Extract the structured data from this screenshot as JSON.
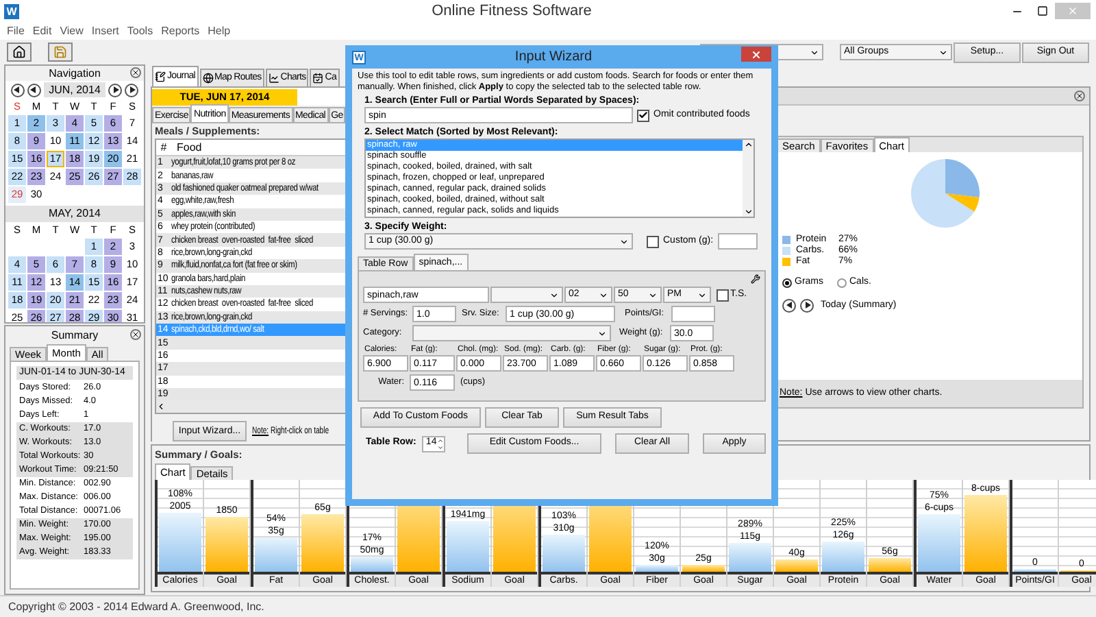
{
  "window": {
    "app_icon": "W",
    "title": "Online Fitness Software"
  },
  "menu": [
    "File",
    "Edit",
    "View",
    "Insert",
    "Tools",
    "Reports",
    "Help"
  ],
  "toolbar": {
    "group_filter": "All Groups",
    "buttons": [
      "Setup...",
      "Sign Out"
    ]
  },
  "navigation": {
    "title": "Navigation",
    "calendars": [
      {
        "month": "JUN, 2014",
        "weekdays": [
          {
            "label": "S",
            "marked": true
          },
          {
            "label": "M",
            "marked": false
          },
          {
            "label": "T",
            "marked": false
          },
          {
            "label": "W",
            "marked": false
          },
          {
            "label": "T",
            "marked": false
          },
          {
            "label": "F",
            "marked": false
          },
          {
            "label": "S",
            "marked": false
          }
        ],
        "weeks": [
          [
            {
              "day": "1",
              "color": "#c5e0f7",
              "selected": false,
              "marked": false
            },
            {
              "day": "2",
              "color": "#8ec0ea",
              "selected": false,
              "marked": false
            },
            {
              "day": "3",
              "color": "#c5e0f7",
              "selected": false,
              "marked": false
            },
            {
              "day": "4",
              "color": "#b4aee6",
              "selected": false,
              "marked": false
            },
            {
              "day": "5",
              "color": "#c5e0f7",
              "selected": false,
              "marked": false
            },
            {
              "day": "6",
              "color": "#b4aee6",
              "selected": false,
              "marked": false
            },
            {
              "day": "7",
              "selected": false,
              "marked": false
            }
          ],
          [
            {
              "day": "8",
              "color": "#c5e0f7",
              "selected": false,
              "marked": false
            },
            {
              "day": "9",
              "color": "#b4aee6",
              "selected": false,
              "marked": false
            },
            {
              "day": "10",
              "selected": false,
              "marked": false
            },
            {
              "day": "11",
              "color": "#8ec0ea",
              "selected": false,
              "marked": false
            },
            {
              "day": "12",
              "color": "#c5e0f7",
              "selected": false,
              "marked": false
            },
            {
              "day": "13",
              "color": "#b4aee6",
              "selected": false,
              "marked": false
            },
            {
              "day": "14",
              "selected": false,
              "marked": false
            }
          ],
          [
            {
              "day": "15",
              "color": "#c5e0f7",
              "selected": false,
              "marked": false
            },
            {
              "day": "16",
              "color": "#b4aee6",
              "selected": false,
              "marked": false
            },
            {
              "day": "17",
              "color": "#c5e0f7",
              "selected": true,
              "marked": false
            },
            {
              "day": "18",
              "color": "#b4aee6",
              "selected": false,
              "marked": false
            },
            {
              "day": "19",
              "color": "#c5e0f7",
              "selected": false,
              "marked": false
            },
            {
              "day": "20",
              "color": "#8ec0ea",
              "selected": false,
              "marked": false
            },
            {
              "day": "21",
              "selected": false,
              "marked": false
            }
          ],
          [
            {
              "day": "22",
              "color": "#c5e0f7",
              "selected": false,
              "marked": false
            },
            {
              "day": "23",
              "color": "#b4aee6",
              "selected": false,
              "marked": false
            },
            {
              "day": "24",
              "selected": false,
              "marked": false
            },
            {
              "day": "25",
              "color": "#b4aee6",
              "selected": false,
              "marked": false
            },
            {
              "day": "26",
              "color": "#c5e0f7",
              "selected": false,
              "marked": false
            },
            {
              "day": "27",
              "color": "#b4aee6",
              "selected": false,
              "marked": false
            },
            {
              "day": "28",
              "color": "#c5e0f7",
              "selected": false,
              "marked": false
            }
          ],
          [
            {
              "day": "29",
              "color": "#e4eefa",
              "selected": false,
              "marked": true
            },
            {
              "day": "30",
              "selected": false,
              "marked": false
            }
          ]
        ]
      },
      {
        "month": "MAY, 2014",
        "weekdays": [
          {
            "label": "S",
            "marked": false
          },
          {
            "label": "M",
            "marked": false
          },
          {
            "label": "T",
            "marked": false
          },
          {
            "label": "W",
            "marked": false
          },
          {
            "label": "T",
            "marked": false
          },
          {
            "label": "F",
            "marked": false
          },
          {
            "label": "S",
            "marked": false
          }
        ],
        "weeks": [
          [
            {
              "day": "1",
              "color": "#c5e0f7",
              "selected": false,
              "marked": false
            },
            {
              "day": "2",
              "color": "#b4aee6",
              "selected": false,
              "marked": false
            },
            {
              "day": "3",
              "selected": false,
              "marked": false
            }
          ],
          [
            {
              "day": "4",
              "color": "#c5e0f7",
              "selected": false,
              "marked": false
            },
            {
              "day": "5",
              "color": "#b4aee6",
              "selected": false,
              "marked": false
            },
            {
              "day": "6",
              "color": "#c5e0f7",
              "selected": false,
              "marked": false
            },
            {
              "day": "7",
              "color": "#b4aee6",
              "selected": false,
              "marked": false
            },
            {
              "day": "8",
              "color": "#c5e0f7",
              "selected": false,
              "marked": false
            },
            {
              "day": "9",
              "color": "#b4aee6",
              "selected": false,
              "marked": false
            },
            {
              "day": "10",
              "selected": false,
              "marked": false
            }
          ],
          [
            {
              "day": "11",
              "color": "#c5e0f7",
              "selected": false,
              "marked": false
            },
            {
              "day": "12",
              "color": "#b4aee6",
              "selected": false,
              "marked": false
            },
            {
              "day": "13",
              "selected": false,
              "marked": false
            },
            {
              "day": "14",
              "color": "#8ec0ea",
              "selected": false,
              "marked": false
            },
            {
              "day": "15",
              "color": "#c5e0f7",
              "selected": false,
              "marked": false
            },
            {
              "day": "16",
              "color": "#b4aee6",
              "selected": false,
              "marked": false
            },
            {
              "day": "17",
              "selected": false,
              "marked": false
            }
          ],
          [
            {
              "day": "18",
              "color": "#c5e0f7",
              "selected": false,
              "marked": false
            },
            {
              "day": "19",
              "color": "#b4aee6",
              "selected": false,
              "marked": false
            },
            {
              "day": "20",
              "color": "#c5e0f7",
              "selected": false,
              "marked": false
            },
            {
              "day": "21",
              "color": "#b4aee6",
              "selected": false,
              "marked": false
            },
            {
              "day": "22",
              "selected": false,
              "marked": false
            },
            {
              "day": "23",
              "color": "#b4aee6",
              "selected": false,
              "marked": false
            },
            {
              "day": "24",
              "selected": false,
              "marked": false
            }
          ],
          [
            {
              "day": "25",
              "selected": false,
              "marked": false
            },
            {
              "day": "26",
              "color": "#b4aee6",
              "selected": false,
              "marked": false
            },
            {
              "day": "27",
              "color": "#c5e0f7",
              "selected": false,
              "marked": false
            },
            {
              "day": "28",
              "color": "#b4aee6",
              "selected": false,
              "marked": false
            },
            {
              "day": "29",
              "color": "#c5e0f7",
              "selected": false,
              "marked": false
            },
            {
              "day": "30",
              "color": "#b4aee6",
              "selected": false,
              "marked": false
            },
            {
              "day": "31",
              "selected": false,
              "marked": false
            }
          ]
        ]
      }
    ]
  },
  "summary": {
    "title": "Summary",
    "tabs": [
      {
        "label": "Week",
        "selected": false
      },
      {
        "label": "Month",
        "selected": true
      },
      {
        "label": "All",
        "selected": false
      }
    ],
    "range": "JUN-01-14 to JUN-30-14",
    "groups": [
      {
        "shaded": false,
        "rows": [
          {
            "label": "Days Stored:",
            "value": "26.0"
          },
          {
            "label": "Days Missed:",
            "value": "4.0"
          },
          {
            "label": "Days Left:",
            "value": "1"
          }
        ]
      },
      {
        "shaded": true,
        "rows": [
          {
            "label": "C. Workouts:",
            "value": "17.0"
          },
          {
            "label": "W. Workouts:",
            "value": "13.0"
          },
          {
            "label": "Total Workouts:",
            "value": "30"
          },
          {
            "label": "Workout Time:",
            "value": "09:21:50"
          }
        ]
      },
      {
        "shaded": false,
        "rows": [
          {
            "label": "Min. Distance:",
            "value": "002.90"
          },
          {
            "label": "Max. Distance:",
            "value": "006.00"
          },
          {
            "label": "Total Distance:",
            "value": "00071.06"
          }
        ]
      },
      {
        "shaded": true,
        "rows": [
          {
            "label": "Min. Weight:",
            "value": "170.00"
          },
          {
            "label": "Max. Weight:",
            "value": "195.00"
          },
          {
            "label": "Avg. Weight:",
            "value": "183.33"
          }
        ]
      }
    ]
  },
  "main_tabs": [
    {
      "label": "Journal",
      "kind": "journal",
      "selected": true
    },
    {
      "label": "Map Routes",
      "kind": "map",
      "selected": false
    },
    {
      "label": "Charts",
      "kind": "charts",
      "selected": false
    },
    {
      "label": "Ca",
      "kind": "calendar",
      "selected": false
    }
  ],
  "journal": {
    "date": "TUE, JUN 17, 2014",
    "tabs": [
      {
        "label": "Exercise",
        "selected": false
      },
      {
        "label": "Nutrition",
        "selected": true
      },
      {
        "label": "Measurements",
        "selected": false
      },
      {
        "label": "Medical",
        "selected": false
      },
      {
        "label": "Ge",
        "selected": false
      }
    ],
    "meals": {
      "title": "Meals / Supplements:",
      "columns": [
        "#",
        "Food"
      ],
      "rows": [
        {
          "n": "1",
          "food": "yogurt,fruit,lofat,10 grams prot per 8 oz",
          "selected": false
        },
        {
          "n": "2",
          "food": "bananas,raw",
          "selected": false
        },
        {
          "n": "3",
          "food": "old fashioned quaker oatmeal prepared w/wat",
          "selected": false
        },
        {
          "n": "4",
          "food": "egg,white,raw,fresh",
          "selected": false
        },
        {
          "n": "5",
          "food": "apples,raw,with skin",
          "selected": false
        },
        {
          "n": "6",
          "food": "whey protein (contributed)",
          "selected": false
        },
        {
          "n": "7",
          "food": "chicken breast  oven-roasted  fat-free  sliced",
          "selected": false
        },
        {
          "n": "8",
          "food": "rice,brown,long-grain,ckd",
          "selected": false
        },
        {
          "n": "9",
          "food": "milk,fluid,nonfat,ca fort (fat free or skim)",
          "selected": false
        },
        {
          "n": "10",
          "food": "granola bars,hard,plain",
          "selected": false
        },
        {
          "n": "11",
          "food": "nuts,cashew nuts,raw",
          "selected": false
        },
        {
          "n": "12",
          "food": "chicken breast  oven-roasted  fat-free  sliced",
          "selected": false
        },
        {
          "n": "13",
          "food": "rice,brown,long-grain,ckd",
          "selected": false
        },
        {
          "n": "14",
          "food": "spinach,ckd,bld,drnd,wo/ salt",
          "selected": true
        },
        {
          "n": "15",
          "selected": false
        },
        {
          "n": "16",
          "selected": false
        },
        {
          "n": "17",
          "selected": false
        },
        {
          "n": "18",
          "selected": false
        },
        {
          "n": "19",
          "selected": false
        }
      ]
    },
    "wizard_button": "Input Wizard...",
    "note_label": "Note:",
    "note": "Right-click on table"
  },
  "side_panel": {
    "tabs": [
      {
        "label": "Search",
        "selected": false
      },
      {
        "label": "Favorites",
        "selected": false
      },
      {
        "label": "Chart",
        "selected": true
      }
    ],
    "chart_data": {
      "type": "pie",
      "categories": [
        "Protein",
        "Carbs.",
        "Fat"
      ],
      "values": [
        27,
        66,
        7
      ]
    },
    "legend": [
      {
        "percent": "27%",
        "color": "#8ab8e8"
      },
      {
        "percent": "66%",
        "color": "#c8e0f8"
      },
      {
        "percent": "7%",
        "color": "#ffc000"
      }
    ],
    "units": [
      {
        "label": "Grams",
        "selected": true
      },
      {
        "label": "Cals.",
        "selected": false
      }
    ],
    "period": "Today (Summary)",
    "note_label": "Note:",
    "note": "Use arrows to view other charts."
  },
  "goals": {
    "title": "Summary / Goals:",
    "tabs": [
      {
        "label": "Chart",
        "selected": true
      },
      {
        "label": "Details",
        "selected": false
      }
    ],
    "groups": [
      [
        {
          "label": "Calories",
          "kind": "actual",
          "level": 0.64,
          "texts": [
            "108%",
            "2005"
          ]
        },
        {
          "label": "Goal",
          "kind": "goal",
          "level": 0.6,
          "texts": [
            "1850"
          ]
        }
      ],
      [
        {
          "label": "Fat",
          "kind": "actual",
          "level": 0.38,
          "texts": [
            "54%",
            "35g"
          ]
        },
        {
          "label": "Goal",
          "kind": "goal",
          "level": 0.63,
          "texts": [
            "65g"
          ]
        }
      ],
      [
        {
          "label": "Cholest.",
          "kind": "actual",
          "level": 0.17,
          "texts": [
            "17%",
            "50mg"
          ]
        },
        {
          "label": "Goal",
          "kind": "goal",
          "level": 1
        }
      ],
      [
        {
          "label": "Sodium",
          "kind": "actual",
          "level": 0.55,
          "texts": [
            "1941mg"
          ]
        },
        {
          "label": "Goal",
          "kind": "goal",
          "level": 1
        }
      ],
      [
        {
          "label": "Carbs.",
          "kind": "actual",
          "level": 0.4,
          "texts": [
            "103%",
            "310g"
          ]
        },
        {
          "label": "Goal",
          "kind": "goal",
          "level": 1
        },
        {
          "label": "Fiber",
          "kind": "actual",
          "level": 0.08,
          "texts": [
            "120%",
            "30g"
          ]
        },
        {
          "label": "Goal",
          "kind": "goal",
          "level": 0.07,
          "texts": [
            "25g"
          ]
        },
        {
          "label": "Sugar",
          "kind": "actual",
          "level": 0.31,
          "texts": [
            "289%",
            "115g"
          ]
        },
        {
          "label": "Goal",
          "kind": "goal",
          "level": 0.13,
          "texts": [
            "40g"
          ]
        },
        {
          "label": "Protein",
          "kind": "actual",
          "level": 0.33,
          "texts": [
            "225%",
            "126g"
          ]
        },
        {
          "label": "Goal",
          "kind": "goal",
          "level": 0.15,
          "texts": [
            "56g"
          ]
        }
      ],
      [
        {
          "label": "Water",
          "kind": "actual",
          "level": 0.62,
          "texts": [
            "75%",
            "6-cups"
          ]
        },
        {
          "label": "Goal",
          "kind": "goal",
          "level": 0.83,
          "texts": [
            "8-cups"
          ]
        }
      ],
      [
        {
          "label": "Points/GI",
          "kind": "actual",
          "level": 0.03,
          "texts": [
            "0"
          ]
        },
        {
          "label": "Goal",
          "kind": "goal",
          "level": 0.02,
          "texts": [
            "0"
          ]
        }
      ]
    ]
  },
  "wizard": {
    "app_icon": "W",
    "title": "Input Wizard",
    "description": "Use this tool to edit table rows, sum ingredients or add custom foods.  Search for foods or enter them manually.  When finished, click **Apply** to copy the selected tab to the selected table row.",
    "search": {
      "label": "1.  Search (Enter Full or Partial Words Separated by Spaces):",
      "value": "spin",
      "omit": {
        "label": "Omit contributed foods",
        "checked": true
      }
    },
    "matches": {
      "label": "2.  Select Match (Sorted by Most Relevant):",
      "items": [
        {
          "text": "spinach, raw",
          "selected": true
        },
        {
          "text": "spinach souffle",
          "selected": false
        },
        {
          "text": "spinach, cooked, boiled, drained, with salt",
          "selected": false
        },
        {
          "text": "spinach, frozen, chopped or leaf, unprepared",
          "selected": false
        },
        {
          "text": "spinach, canned, regular pack, drained solids",
          "selected": false
        },
        {
          "text": "spinach, cooked, boiled, drained, without salt",
          "selected": false
        },
        {
          "text": "spinach, canned, regular pack, solids and liquids",
          "selected": false
        }
      ]
    },
    "weight": {
      "label": "3.  Specify Weight:",
      "value": "1 cup (30.00 g)",
      "custom": {
        "label": "Custom (g):",
        "checked": false
      }
    },
    "tabs": [
      {
        "label": "Table Row",
        "selected": false
      },
      {
        "label": "spinach,...",
        "selected": true
      }
    ],
    "entry": {
      "name": "spinach,raw",
      "selects": [
        "02",
        "50",
        "PM"
      ],
      "ts": {
        "label": "T.S.",
        "checked": false
      },
      "servings": {
        "label": "# Servings:",
        "value": "1.0"
      },
      "serving_size": {
        "label": "Srv. Size:",
        "value": "1 cup (30.00 g)"
      },
      "points_label": "Points/GI:",
      "category_label": "Category:",
      "weight": {
        "label": "Weight (g):",
        "value": "30.0"
      },
      "nutrients": [
        {
          "label": "Calories:",
          "value": "6.900"
        },
        {
          "label": "Fat (g):",
          "value": "0.117"
        },
        {
          "label": "Chol. (mg):",
          "value": "0.000"
        },
        {
          "label": "Sod. (mg):",
          "value": "23.700"
        },
        {
          "label": "Carb. (g):",
          "value": "1.089"
        },
        {
          "label": "Fiber (g):",
          "value": "0.660"
        },
        {
          "label": "Sugar (g):",
          "value": "0.126"
        },
        {
          "label": "Prot. (g):",
          "value": "0.858"
        }
      ],
      "water": {
        "label": "Water:",
        "value": "0.116",
        "unit": "(cups)"
      }
    },
    "buttons": [
      "Add To Custom Foods",
      "Clear Tab",
      "Sum Result Tabs"
    ],
    "table_row": {
      "label": "Table Row:",
      "value": "14"
    },
    "bottom_buttons": [
      "Edit Custom Foods...",
      "Clear All",
      "Apply"
    ]
  },
  "status_bar": "Copyright © 2003 - 2014 Edward A. Greenwood, Inc."
}
